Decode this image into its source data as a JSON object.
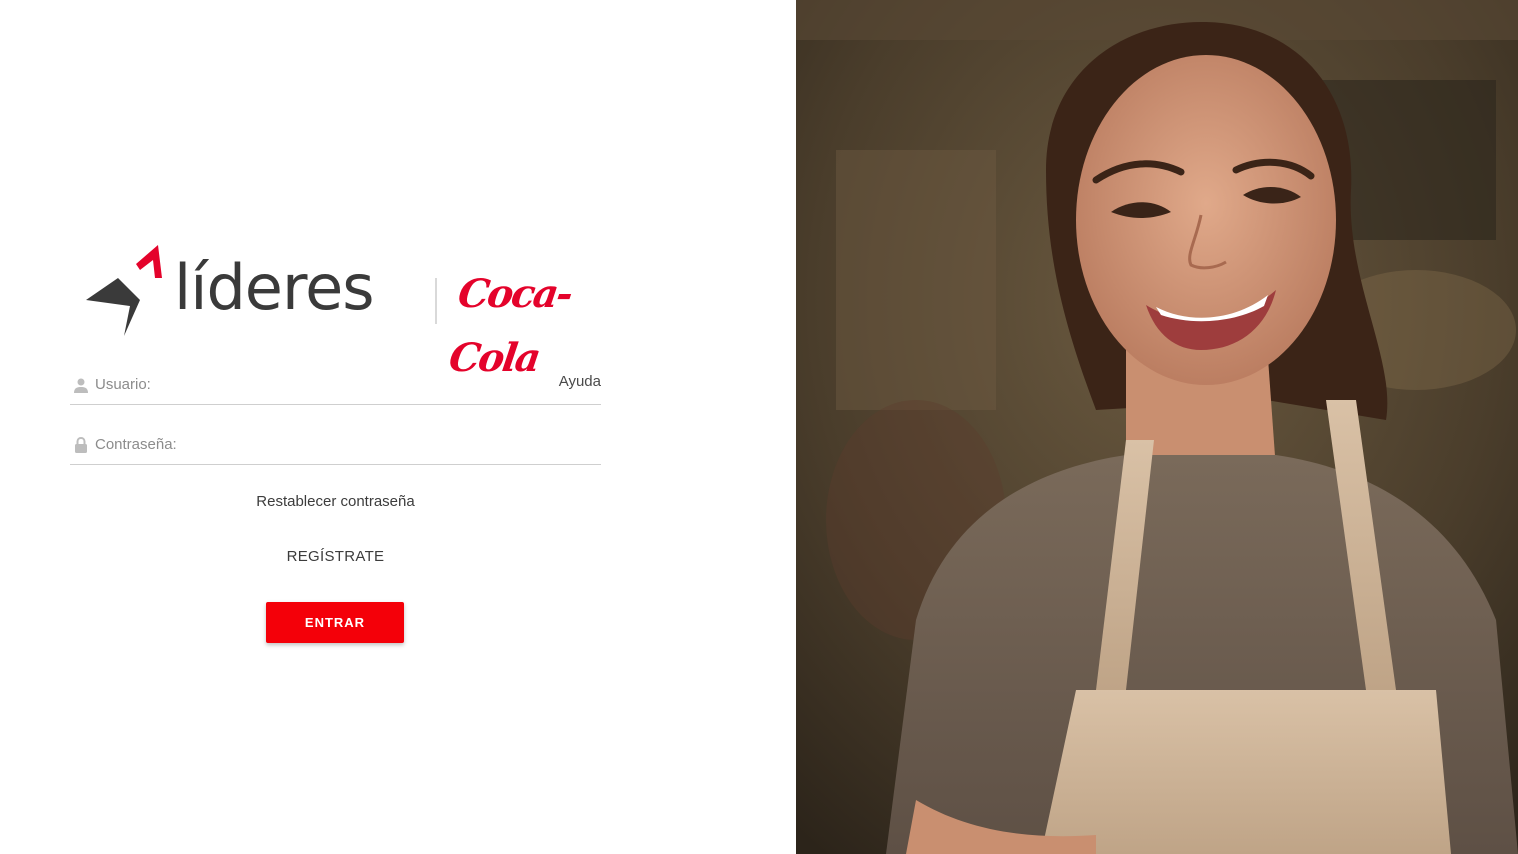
{
  "brand": {
    "wordmark": "líderes",
    "partner": "Coca-Cola",
    "accent_color": "#f40009",
    "mark_color": "#3a3a3a"
  },
  "login_form": {
    "username": {
      "placeholder": "Usuario:",
      "value": "",
      "icon": "user-icon"
    },
    "password": {
      "placeholder": "Contraseña:",
      "value": "",
      "icon": "lock-icon"
    },
    "help_label": "Ayuda",
    "reset_password_label": "Restablecer contraseña",
    "register_label": "REGÍSTRATE",
    "submit_label": "ENTRAR"
  },
  "hero": {
    "icon": "hero-photo"
  }
}
